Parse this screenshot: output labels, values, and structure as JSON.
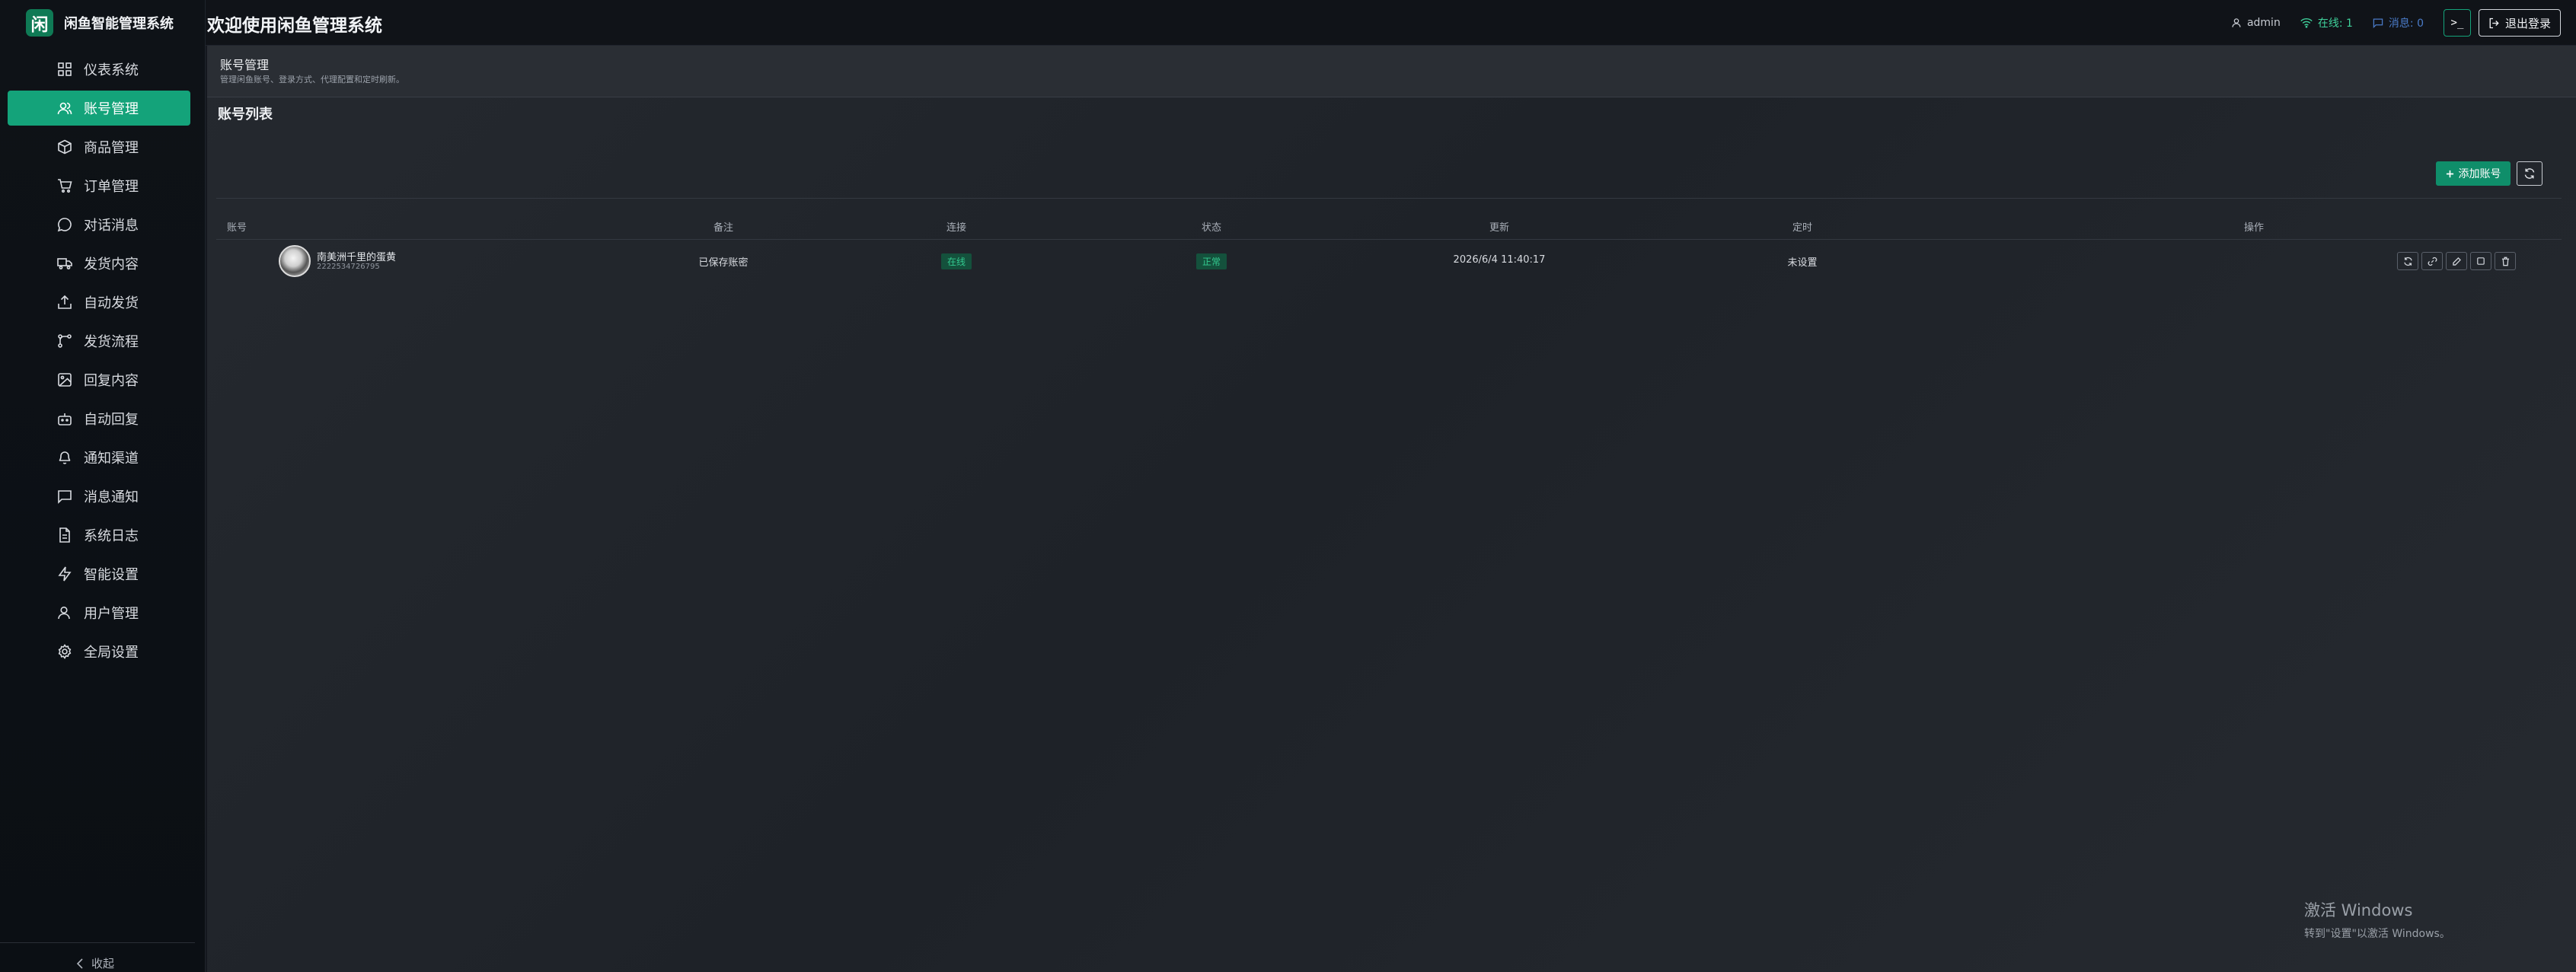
{
  "brand": {
    "logo_char": "闲",
    "name": "闲鱼智能管理系统"
  },
  "header": {
    "title": "欢迎使用闲鱼管理系统",
    "user": "admin",
    "online": "在线: 1",
    "messages": "消息: 0",
    "terminal_glyph": ">_",
    "logout": "退出登录"
  },
  "sidebar": {
    "items": [
      {
        "label": "仪表系统",
        "icon": "dashboard-icon",
        "active": false
      },
      {
        "label": "账号管理",
        "icon": "users-icon",
        "active": true
      },
      {
        "label": "商品管理",
        "icon": "box-icon",
        "active": false
      },
      {
        "label": "订单管理",
        "icon": "cart-icon",
        "active": false
      },
      {
        "label": "对话消息",
        "icon": "chat-icon",
        "active": false
      },
      {
        "label": "发货内容",
        "icon": "truck-icon",
        "active": false
      },
      {
        "label": "自动发货",
        "icon": "upload-icon",
        "active": false
      },
      {
        "label": "发货流程",
        "icon": "flow-icon",
        "active": false
      },
      {
        "label": "回复内容",
        "icon": "image-icon",
        "active": false
      },
      {
        "label": "自动回复",
        "icon": "bot-icon",
        "active": false
      },
      {
        "label": "通知渠道",
        "icon": "bell-icon",
        "active": false
      },
      {
        "label": "消息通知",
        "icon": "message-icon",
        "active": false
      },
      {
        "label": "系统日志",
        "icon": "file-icon",
        "active": false
      },
      {
        "label": "智能设置",
        "icon": "bolt-icon",
        "active": false
      },
      {
        "label": "用户管理",
        "icon": "user-icon",
        "active": false
      },
      {
        "label": "全局设置",
        "icon": "gear-icon",
        "active": false
      }
    ],
    "collapse": "收起"
  },
  "page": {
    "title": "账号管理",
    "description": "管理闲鱼账号、登录方式、代理配置和定时刷新。"
  },
  "list": {
    "title": "账号列表",
    "add_button": "添加账号",
    "columns": [
      "账号",
      "备注",
      "连接",
      "状态",
      "更新",
      "定时",
      "操作"
    ],
    "rows": [
      {
        "name": "南美洲千里的蛋黄",
        "id": "2222534726795",
        "remark": "已保存账密",
        "connection": "在线",
        "status": "正常",
        "updated": "2026/6/4 11:40:17",
        "schedule": "未设置"
      }
    ]
  },
  "watermark": {
    "line1": "激活 Windows",
    "line2": "转到\"设置\"以激活 Windows。"
  },
  "colors": {
    "accent": "#14a37a",
    "badge_bg": "#14513c",
    "badge_text": "#33c98f",
    "online": "#3fd19b"
  }
}
